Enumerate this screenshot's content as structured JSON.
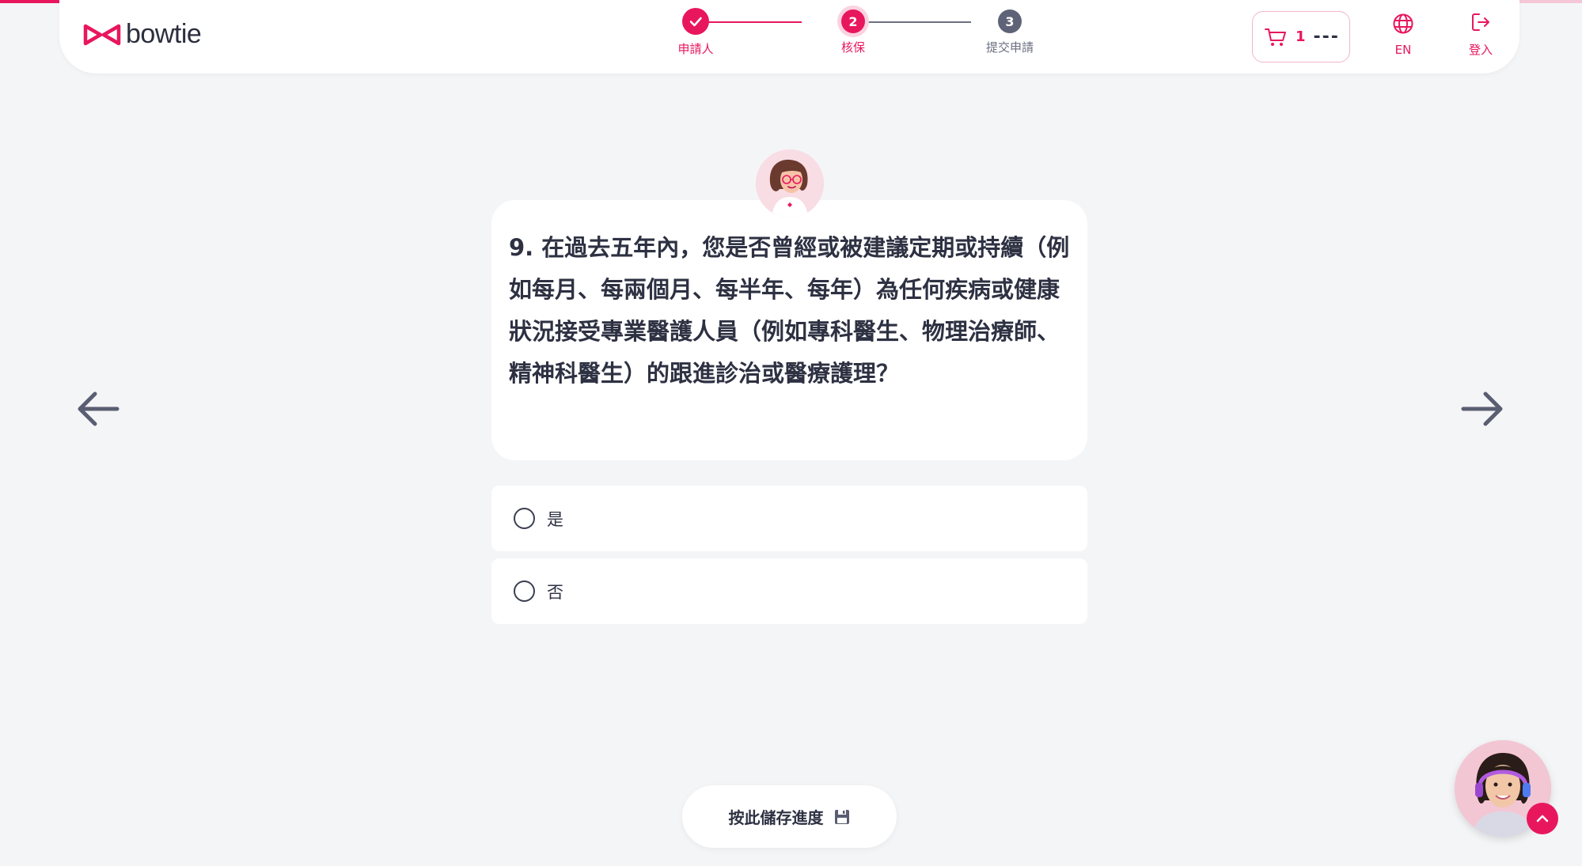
{
  "header": {
    "brand": "bowtie",
    "steps": [
      {
        "number": "",
        "label": "申請人",
        "state": "done"
      },
      {
        "number": "2",
        "label": "核保",
        "state": "active"
      },
      {
        "number": "3",
        "label": "提交申請",
        "state": "pending"
      }
    ],
    "cart": {
      "count": "1",
      "total": "---"
    },
    "language_label": "EN",
    "login_label": "登入"
  },
  "progress": {
    "fraction": 0.67
  },
  "question": {
    "text": "9. 在過去五年內，您是否曾經或被建議定期或持續（例如每月、每兩個月、每半年、每年）為任何疾病或健康狀況接受專業醫護人員（例如專科醫生、物理治療師、精神科醫生）的跟進診治或醫療護理？"
  },
  "options": [
    {
      "label": "是"
    },
    {
      "label": "否"
    }
  ],
  "save_button": {
    "label": "按此儲存進度"
  },
  "colors": {
    "accent": "#e8175d",
    "background": "#f4f5f7",
    "text": "#2d3142"
  },
  "icons": [
    "bowtie-logo-icon",
    "check-icon",
    "cart-icon",
    "globe-icon",
    "logout-icon",
    "arrow-left-icon",
    "arrow-right-icon",
    "save-disk-icon",
    "chevron-up-icon"
  ]
}
